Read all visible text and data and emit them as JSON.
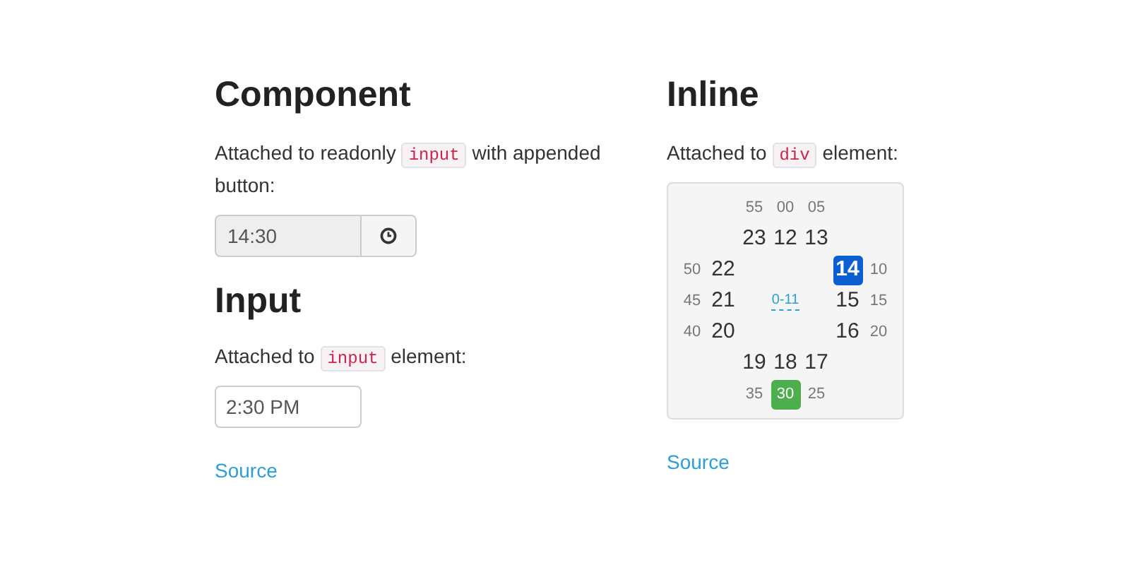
{
  "component": {
    "title": "Component",
    "text": "Attached to readonly",
    "code": "input",
    "text_after": "with appended button:",
    "value": "14:30"
  },
  "input": {
    "title": "Input",
    "text": "Attached to",
    "code": "input",
    "text_after": "element:",
    "value": "2:30 PM",
    "link": "Source"
  },
  "inline": {
    "title": "Inline",
    "text": "Attached to",
    "code": "div",
    "text_after": "element:",
    "link": "Source",
    "hours": [
      {
        "label": "23",
        "selected": false
      },
      {
        "label": "12",
        "selected": false
      },
      {
        "label": "13",
        "selected": false
      },
      {
        "label": "22",
        "selected": false
      },
      {
        "label": "14",
        "selected": true
      },
      {
        "label": "21",
        "selected": false
      },
      {
        "label": "15",
        "selected": false
      },
      {
        "label": "20",
        "selected": false
      },
      {
        "label": "16",
        "selected": false
      },
      {
        "label": "19",
        "selected": false
      },
      {
        "label": "18",
        "selected": false
      },
      {
        "label": "17",
        "selected": false
      }
    ],
    "minutes": [
      {
        "label": "55",
        "selected": false
      },
      {
        "label": "00",
        "selected": false
      },
      {
        "label": "05",
        "selected": false
      },
      {
        "label": "50",
        "selected": false
      },
      {
        "label": "10",
        "selected": false
      },
      {
        "label": "45",
        "selected": false
      },
      {
        "label": "15",
        "selected": false
      },
      {
        "label": "40",
        "selected": false
      },
      {
        "label": "20",
        "selected": false
      },
      {
        "label": "35",
        "selected": false
      },
      {
        "label": "30",
        "selected": true
      },
      {
        "label": "25",
        "selected": false
      }
    ],
    "toggle": "0-11"
  }
}
